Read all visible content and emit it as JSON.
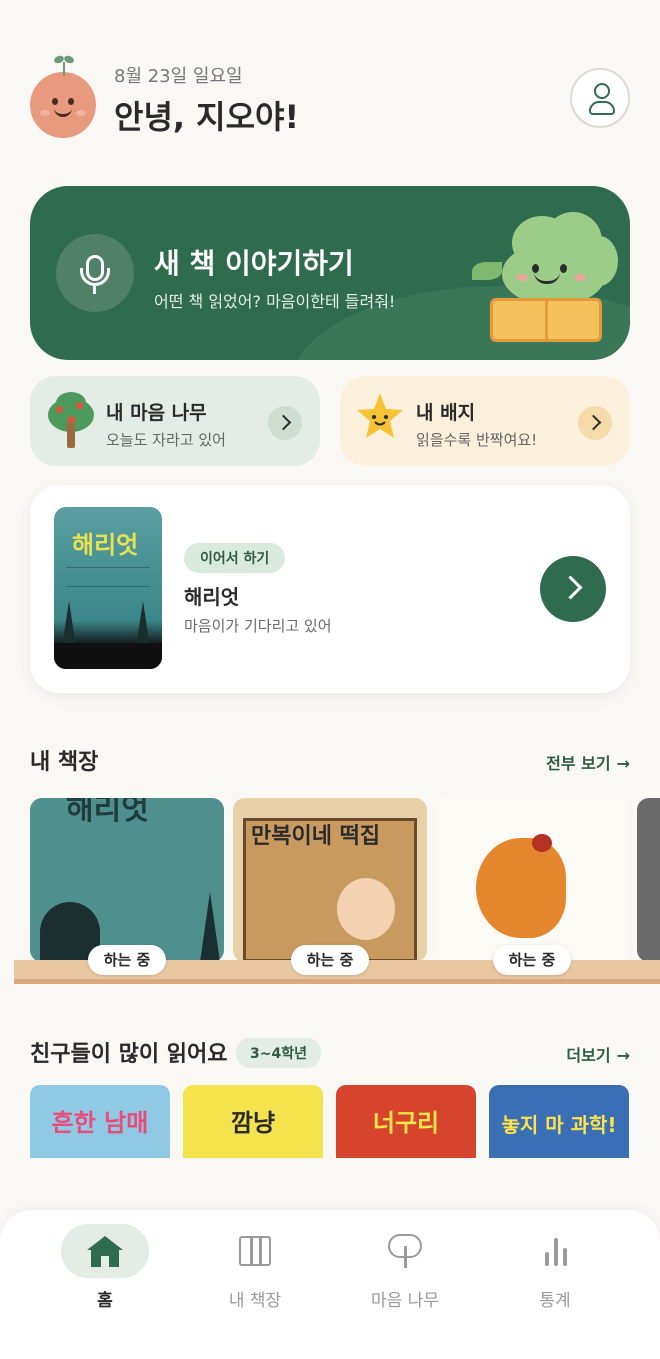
{
  "header": {
    "date": "8월 23일 일요일",
    "greeting": "안녕, 지오야!"
  },
  "hero": {
    "title": "새 책 이야기하기",
    "subtitle": "어떤 책 읽었어? 마음이한테 들려줘!"
  },
  "cards": {
    "tree": {
      "title": "내 마음 나무",
      "subtitle": "오늘도 자라고 있어"
    },
    "badge": {
      "title": "내 배지",
      "subtitle": "읽을수록 반짝여요!"
    }
  },
  "continue_reading": {
    "chip": "이어서 하기",
    "book_title": "해리엇",
    "subtitle": "마음이가 기다리고 있어",
    "cover_title": "해리엇"
  },
  "shelf": {
    "title": "내 책장",
    "link": "전부 보기",
    "books": [
      {
        "status": "하는 중"
      },
      {
        "status": "하는 중"
      },
      {
        "status": "하는 중"
      }
    ],
    "cover_titles": [
      "해리엇",
      "만복이네 떡집"
    ]
  },
  "popular": {
    "title": "친구들이 많이 읽어요",
    "grade": "3~4학년",
    "link": "더보기",
    "books": [
      {
        "cover_title": "흔한 남매"
      },
      {
        "cover_title": "깜냥"
      },
      {
        "cover_title": "너구리"
      },
      {
        "cover_title": "놓지 마 과학!"
      }
    ]
  },
  "bottom_nav": {
    "items": [
      {
        "label": "홈",
        "active": true
      },
      {
        "label": "내 책장",
        "active": false
      },
      {
        "label": "마음 나무",
        "active": false
      },
      {
        "label": "통계",
        "active": false
      }
    ]
  },
  "colors": {
    "primary": "#2f6b4f",
    "background": "#faf8f5",
    "tree_card": "#e3ece5",
    "badge_card": "#fbf0dc"
  },
  "icons": [
    "avatar-icon",
    "user-icon",
    "mic-icon",
    "tree-icon",
    "star-icon",
    "chevron-right-icon",
    "arrow-right-icon",
    "home-icon",
    "books-icon",
    "tree-nav-icon",
    "stats-icon"
  ]
}
